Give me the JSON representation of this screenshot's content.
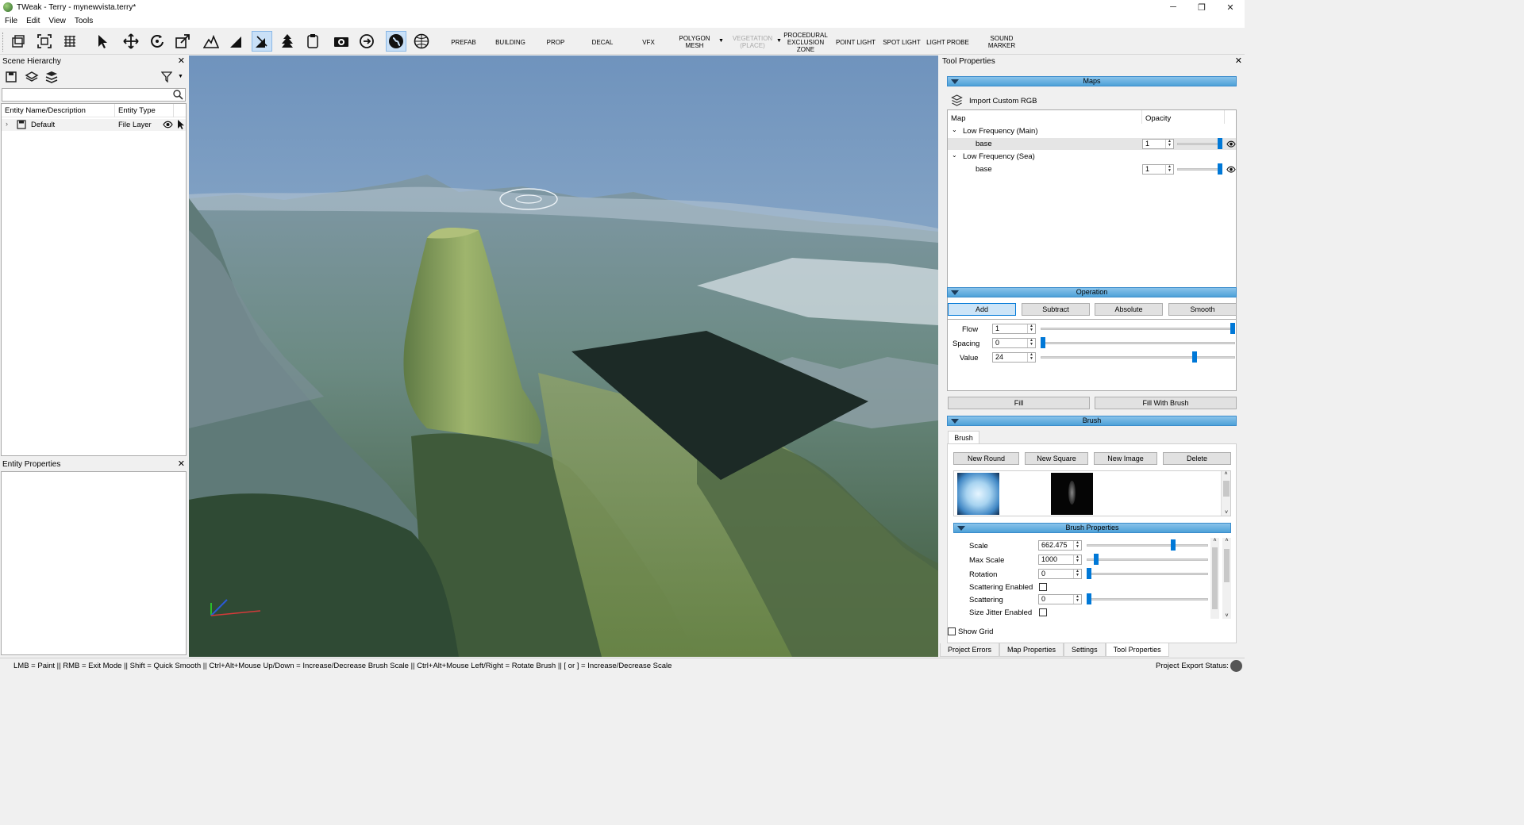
{
  "window": {
    "title": "TWeak - Terry - mynewvista.terry*",
    "minimize": "─",
    "maximize": "❐",
    "close": "✕"
  },
  "menu": [
    "File",
    "Edit",
    "View",
    "Tools"
  ],
  "toolbar": {
    "entities": [
      {
        "label": "PREFAB"
      },
      {
        "label": "BUILDING"
      },
      {
        "label": "PROP"
      },
      {
        "label": "DECAL"
      },
      {
        "label": "VFX"
      },
      {
        "label": "POLYGON MESH"
      },
      {
        "label": "VEGETATION (PLACE)"
      },
      {
        "label": "PROCEDURAL EXCLUSION ZONE"
      },
      {
        "label": "POINT LIGHT"
      },
      {
        "label": "SPOT LIGHT"
      },
      {
        "label": "LIGHT PROBE"
      },
      {
        "label": "SOUND MARKER"
      }
    ]
  },
  "scene_hierarchy": {
    "title": "Scene Hierarchy",
    "search_placeholder": "",
    "columns": [
      "Entity Name/Description",
      "Entity Type"
    ],
    "rows": [
      {
        "name": "Default",
        "type": "File Layer"
      }
    ]
  },
  "entity_properties": {
    "title": "Entity Properties"
  },
  "tool_properties": {
    "title": "Tool Properties",
    "maps": {
      "header": "Maps",
      "import_label": "Import Custom RGB",
      "columns": [
        "Map",
        "Opacity"
      ],
      "groups": [
        {
          "name": "Low Frequency (Main)",
          "child": "base",
          "opacity": "1",
          "opacity_level": 1.0
        },
        {
          "name": "Low Frequency (Sea)",
          "child": "base",
          "opacity": "1",
          "opacity_level": 1.0
        }
      ]
    },
    "operation": {
      "header": "Operation",
      "buttons": [
        "Add",
        "Subtract",
        "Absolute",
        "Smooth"
      ],
      "selected": "Add",
      "params": [
        {
          "label": "Flow",
          "value": "1",
          "level": 1.0
        },
        {
          "label": "Spacing",
          "value": "0",
          "level": 0.0
        },
        {
          "label": "Value",
          "value": "24",
          "level": 0.8
        }
      ],
      "fill_label": "Fill",
      "fill_brush_label": "Fill With Brush"
    },
    "brush": {
      "header": "Brush",
      "tab": "Brush",
      "buttons": [
        "New Round",
        "New Square",
        "New Image",
        "Delete"
      ]
    },
    "brush_properties": {
      "header": "Brush Properties",
      "params": [
        {
          "label": "Scale",
          "value": "662.475",
          "level": 0.72
        },
        {
          "label": "Max Scale",
          "value": "1000",
          "level": 0.06
        },
        {
          "label": "Rotation",
          "value": "0",
          "level": 0.0
        },
        {
          "label": "Scattering Enabled",
          "checkbox": true
        },
        {
          "label": "Scattering",
          "value": "0",
          "level": 0.0
        },
        {
          "label": "Size Jitter Enabled",
          "checkbox": true
        }
      ]
    },
    "show_grid": "Show Grid"
  },
  "bottom_tabs": [
    "Project Errors",
    "Map Properties",
    "Settings",
    "Tool Properties"
  ],
  "active_bottom_tab": "Tool Properties",
  "status": {
    "hint": "LMB = Paint || RMB = Exit Mode || Shift = Quick Smooth || Ctrl+Alt+Mouse Up/Down = Increase/Decrease Brush Scale || Ctrl+Alt+Mouse Left/Right = Rotate Brush || [ or ] = Increase/Decrease Scale",
    "export": "Project Export Status:"
  },
  "colors": {
    "accent": "#0078d7",
    "section_header": "#4ea1d8",
    "dark_patch": "#1c2a26"
  }
}
